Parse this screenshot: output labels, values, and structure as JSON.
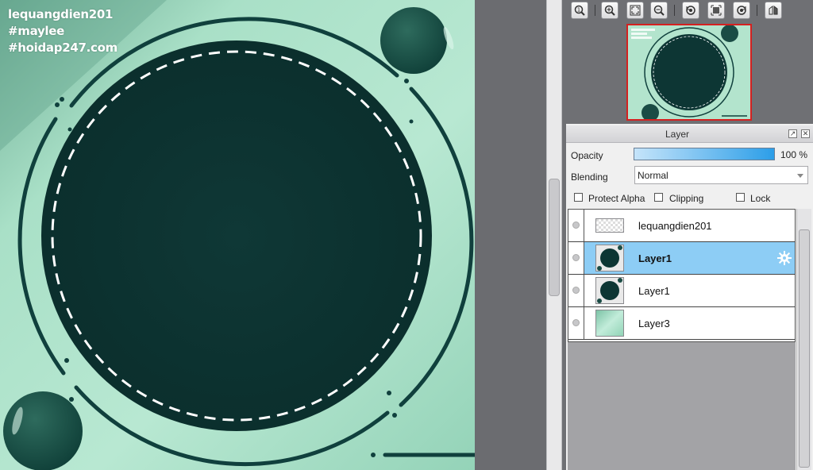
{
  "canvas": {
    "watermark": [
      "lequangdien201",
      "#maylee",
      "#hoidap247.com"
    ],
    "colors": {
      "background": "#a9e0c6",
      "circle": "#0d3634",
      "ring": "#10403d",
      "dash": "#ffffff"
    }
  },
  "navigator": {
    "toolbar": [
      {
        "name": "zoom-actual-icon"
      },
      {
        "name": "zoom-in-icon"
      },
      {
        "name": "fit-window-icon"
      },
      {
        "name": "zoom-out-icon"
      },
      {
        "name": "rotate-left-icon"
      },
      {
        "name": "fit-screen-icon"
      },
      {
        "name": "rotate-right-icon"
      },
      {
        "name": "flip-horizontal-icon"
      }
    ],
    "preview_border_color": "#d52020"
  },
  "layer_panel": {
    "title": "Layer",
    "opacity_label": "Opacity",
    "opacity_value": "100 %",
    "opacity_level": 1.0,
    "blending_label": "Blending",
    "blending_value": "Normal",
    "checkboxes": {
      "protect_alpha": "Protect Alpha",
      "clipping": "Clipping",
      "lock": "Lock"
    },
    "layers": [
      {
        "name": "lequangdien201",
        "selected": false,
        "thumb": "text"
      },
      {
        "name": "Layer1",
        "selected": true,
        "thumb": "circle"
      },
      {
        "name": "Layer1",
        "selected": false,
        "thumb": "circle"
      },
      {
        "name": "Layer3",
        "selected": false,
        "thumb": "gradient"
      }
    ],
    "accent_color": "#8dcdf5"
  }
}
